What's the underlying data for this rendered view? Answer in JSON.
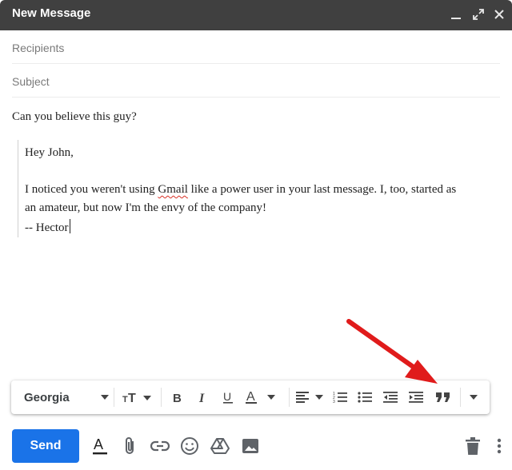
{
  "window": {
    "title": "New Message",
    "titlebar_color": "#404040"
  },
  "fields": {
    "recipients_placeholder": "Recipients",
    "subject_placeholder": "Subject"
  },
  "body": {
    "first_line": "Can you believe this guy?",
    "quoted": {
      "greeting": "Hey John,",
      "line1_pre": "I noticed you weren't using ",
      "line1_misspelled": "Gmail",
      "line1_post": " like a power user in your last message. I, too, started as",
      "line2": "an amateur, but now I'm the envy of the company!",
      "signature": "-- Hector"
    }
  },
  "format_toolbar": {
    "font": "Georgia",
    "icons": [
      "font-size-icon",
      "bold-icon",
      "italic-icon",
      "underline-icon",
      "text-color-icon",
      "align-icon",
      "numbered-list-icon",
      "bulleted-list-icon",
      "indent-less-icon",
      "indent-more-icon",
      "quote-icon",
      "more-formatting-icon"
    ]
  },
  "bottom_bar": {
    "send_label": "Send",
    "send_color": "#1a73e8",
    "icons": [
      "formatting-options-icon",
      "attach-icon",
      "link-icon",
      "emoji-icon",
      "drive-icon",
      "photo-icon",
      "trash-icon",
      "more-options-icon"
    ]
  },
  "annotation": {
    "arrow_color": "#e01b1b",
    "points_to": "quote-icon"
  }
}
